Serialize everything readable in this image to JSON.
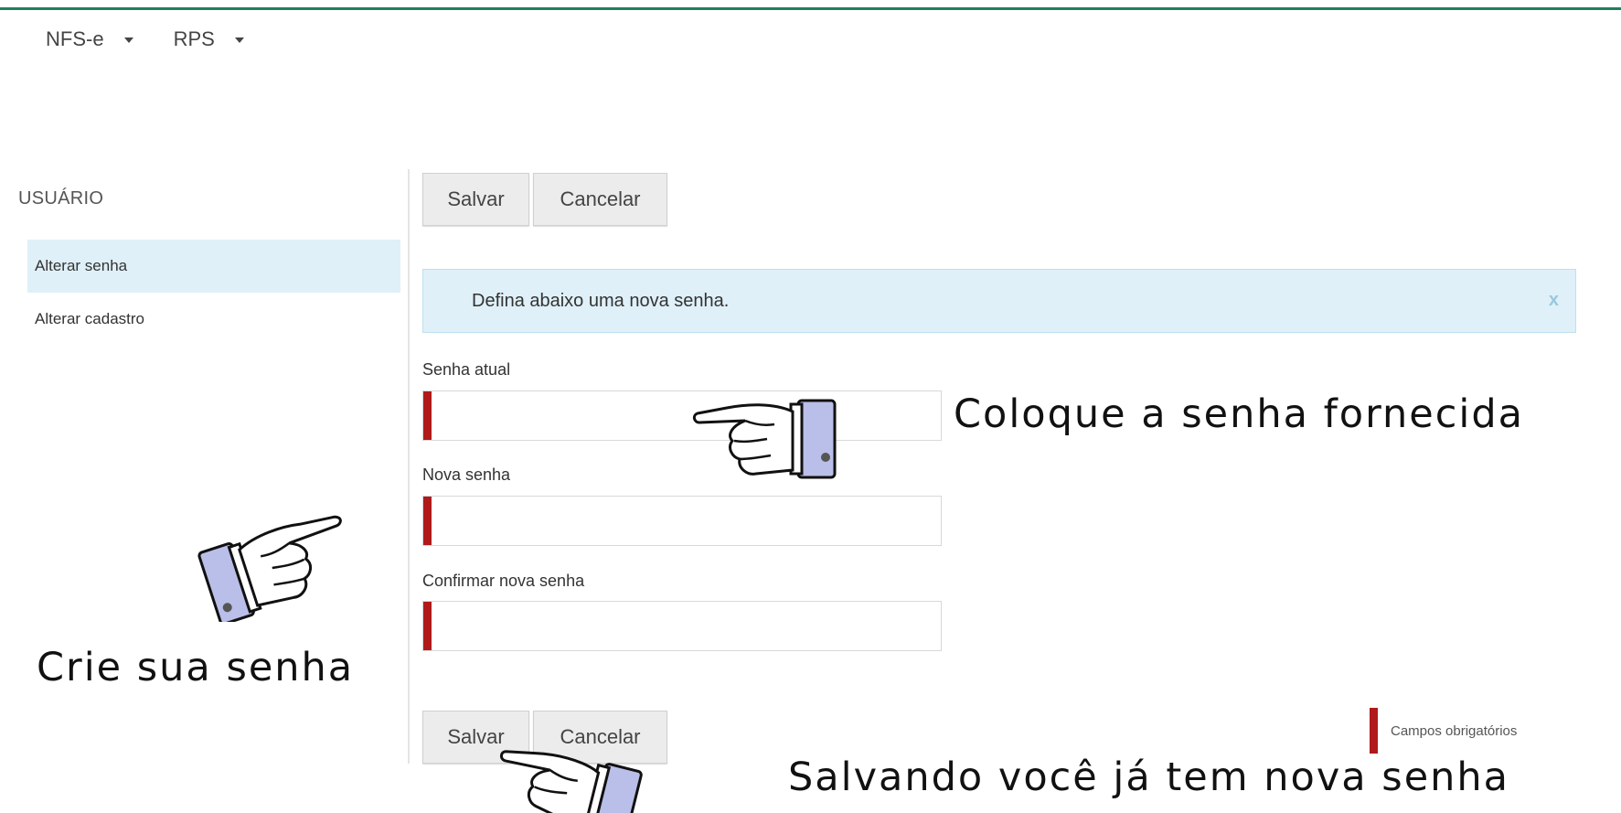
{
  "nav": {
    "nfse": "NFS-e",
    "rps": "RPS"
  },
  "sidebar": {
    "title": "USUÁRIO",
    "items": [
      {
        "label": "Alterar senha",
        "active": true
      },
      {
        "label": "Alterar cadastro",
        "active": false
      }
    ]
  },
  "toolbar": {
    "save_label": "Salvar",
    "cancel_label": "Cancelar"
  },
  "alert": {
    "message": "Defina abaixo uma nova senha.",
    "close": "x"
  },
  "form": {
    "current_password": {
      "label": "Senha atual",
      "value": ""
    },
    "new_password": {
      "label": "Nova senha",
      "value": ""
    },
    "confirm_password": {
      "label": "Confirmar nova senha",
      "value": ""
    }
  },
  "required_legend": "Campos obrigatórios",
  "annotations": {
    "provided": "Coloque a senha fornecida",
    "create": "Crie sua senha",
    "saving": "Salvando você já tem nova senha"
  },
  "colors": {
    "accent_line": "#1e7f5c",
    "required": "#b01a1a",
    "info_bg": "#dff0f8"
  }
}
